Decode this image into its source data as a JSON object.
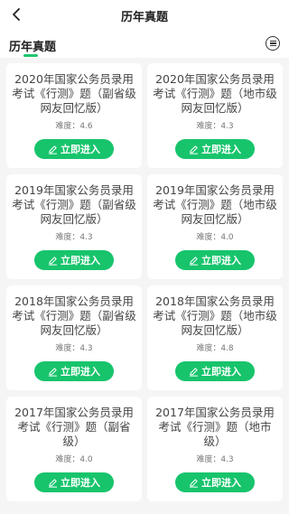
{
  "nav": {
    "title": "历年真题"
  },
  "subbar": {
    "title": "历年真题"
  },
  "cards": [
    {
      "title": "2020年国家公务员录用考试《行测》题（副省级网友回忆版）",
      "difficulty": "难度：4.6",
      "button": "立即进入"
    },
    {
      "title": "2020年国家公务员录用考试《行测》题（地市级网友回忆版）",
      "difficulty": "难度：4.3",
      "button": "立即进入"
    },
    {
      "title": "2019年国家公务员录用考试《行测》题（副省级网友回忆版）",
      "difficulty": "难度：4.3",
      "button": "立即进入"
    },
    {
      "title": "2019年国家公务员录用考试《行测》题（地市级网友回忆版）",
      "difficulty": "难度：4.0",
      "button": "立即进入"
    },
    {
      "title": "2018年国家公务员录用考试《行测》题（副省级网友回忆版）",
      "difficulty": "难度：4.3",
      "button": "立即进入"
    },
    {
      "title": "2018年国家公务员录用考试《行测》题（地市级网友回忆版）",
      "difficulty": "难度：4.8",
      "button": "立即进入"
    },
    {
      "title": "2017年国家公务员录用考试《行测》题（副省级）",
      "difficulty": "难度：4.0",
      "button": "立即进入"
    },
    {
      "title": "2017年国家公务员录用考试《行测》题（地市级）",
      "difficulty": "难度：4.3",
      "button": "立即进入"
    }
  ],
  "colors": {
    "accent": "#17c46c",
    "background": "#f5f5f5"
  },
  "icons": {
    "back": "chevron-left-icon",
    "menu": "list-icon",
    "button": "edit-icon"
  }
}
